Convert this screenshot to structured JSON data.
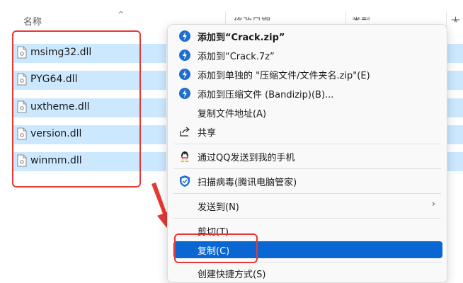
{
  "header": {
    "col_name": "名称",
    "col_modified": "修改日期",
    "col_type": "类型",
    "col_size": "大"
  },
  "files": [
    {
      "name": "msimg32.dll"
    },
    {
      "name": "PYG64.dll"
    },
    {
      "name": "uxtheme.dll"
    },
    {
      "name": "version.dll"
    },
    {
      "name": "winmm.dll"
    }
  ],
  "menu": {
    "items": [
      {
        "label": "添加到“Crack.zip”",
        "icon": "bandizip-icon"
      },
      {
        "label": "添加到“Crack.7z”",
        "icon": "bandizip-icon"
      },
      {
        "label": "添加到单独的 \"压缩文件/文件夹名.zip\"(E)",
        "icon": "bandizip-icon"
      },
      {
        "label": "添加到压缩文件 (Bandizip)(B)...",
        "icon": "bandizip-icon"
      },
      {
        "label": "复制文件地址(A)",
        "icon": ""
      },
      {
        "label": "共享",
        "icon": "share-icon"
      },
      {
        "label": "通过QQ发送到我的手机",
        "icon": "qq-icon"
      },
      {
        "label": "扫描病毒(腾讯电脑管家)",
        "icon": "tencent-pc-manager-icon"
      },
      {
        "label": "发送到(N)",
        "icon": ""
      },
      {
        "label": "剪切(T)",
        "icon": ""
      },
      {
        "label": "复制(C)",
        "icon": ""
      },
      {
        "label": "创建快捷方式(S)",
        "icon": ""
      }
    ],
    "highlighted_index": 10
  },
  "colors": {
    "selection": "#cce8ff",
    "highlight": "#0a66d3",
    "annotation": "#e53935"
  }
}
